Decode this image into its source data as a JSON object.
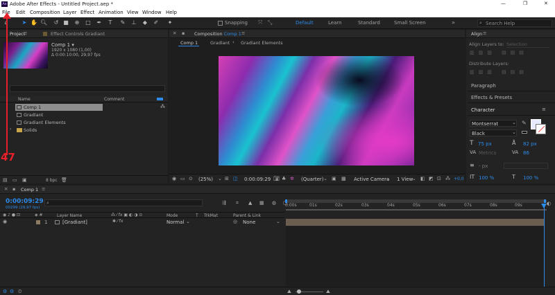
{
  "window": {
    "title": "Adobe After Effects - Untitled Project.aep *",
    "app_badge": "Ae",
    "controls": [
      "—",
      "❐",
      "✕"
    ]
  },
  "menu": [
    "File",
    "Edit",
    "Composition",
    "Layer",
    "Effect",
    "Animation",
    "View",
    "Window",
    "Help"
  ],
  "toolbar": {
    "snapping": "Snapping",
    "workspaces": [
      "Default",
      "Learn",
      "Standard",
      "Small Screen"
    ],
    "workspace_menu": "»",
    "search_placeholder": "Search Help"
  },
  "annotation": {
    "number": "47",
    "color": "#e8202a"
  },
  "project_panel": {
    "tab": "Project",
    "tab_effect_controls": "Effect Controls Gradiant",
    "thumb_name": "Comp 1 ▾",
    "thumb_info": [
      "1920 x 1080 (1,00)",
      "Δ 0:00:10:00, 29,97 fps"
    ],
    "search_placeholder": "",
    "col_name": "Name",
    "col_comment": "Comment",
    "items": [
      {
        "name": "Comp 1",
        "type": "comp",
        "selected": true
      },
      {
        "name": "Gradiant",
        "type": "footage",
        "selected": false
      },
      {
        "name": "Gradiant Elements",
        "type": "comp",
        "selected": false
      },
      {
        "name": "Solids",
        "type": "folder",
        "selected": false
      }
    ],
    "bpc": "8 bpc"
  },
  "composition_panel": {
    "tab": "Composition",
    "tab_name": "Comp 1",
    "breadcrumbs": [
      "Comp 1",
      "Gradiant",
      "Gradiant Elements"
    ],
    "zoom": "(25%)",
    "timecode": "0:00:09:29",
    "resolution": "(Quarter)",
    "camera": "Active Camera",
    "view": "1 View",
    "exposure": "+0,0"
  },
  "right_panel": {
    "align_title": "Align",
    "align_layers_to": "Align Layers to:",
    "align_target": "Selection",
    "distribute_layers": "Distribute Layers:",
    "sections": [
      "Paragraph",
      "Effects & Presets",
      "Character"
    ],
    "font": "Montserrat",
    "font_style": "Black",
    "font_size": "75 px",
    "leading": "82 px",
    "kerning": "Metrics",
    "tracking": "86",
    "stroke": "- px",
    "vscale": "100 %",
    "hscale": "100 %"
  },
  "timeline": {
    "tab": "Comp 1",
    "timecode": "0:00:09:29",
    "frames": "00299 (29,97 fps)",
    "search_placeholder": "",
    "col_layer_name": "Layer Name",
    "col_mode": "Mode",
    "col_t": "T",
    "col_trkmat": "TrkMat",
    "col_parent": "Parent & Link",
    "layers": [
      {
        "num": "1",
        "name": "[Gradiant]",
        "mode": "Normal",
        "parent": "None"
      }
    ],
    "ruler": [
      "0:00s",
      "01s",
      "02s",
      "03s",
      "04s",
      "05s",
      "06s",
      "07s",
      "08s",
      "09s"
    ],
    "accent": "#2d8ceb",
    "layer_bar_color": "#6b5d4f"
  }
}
